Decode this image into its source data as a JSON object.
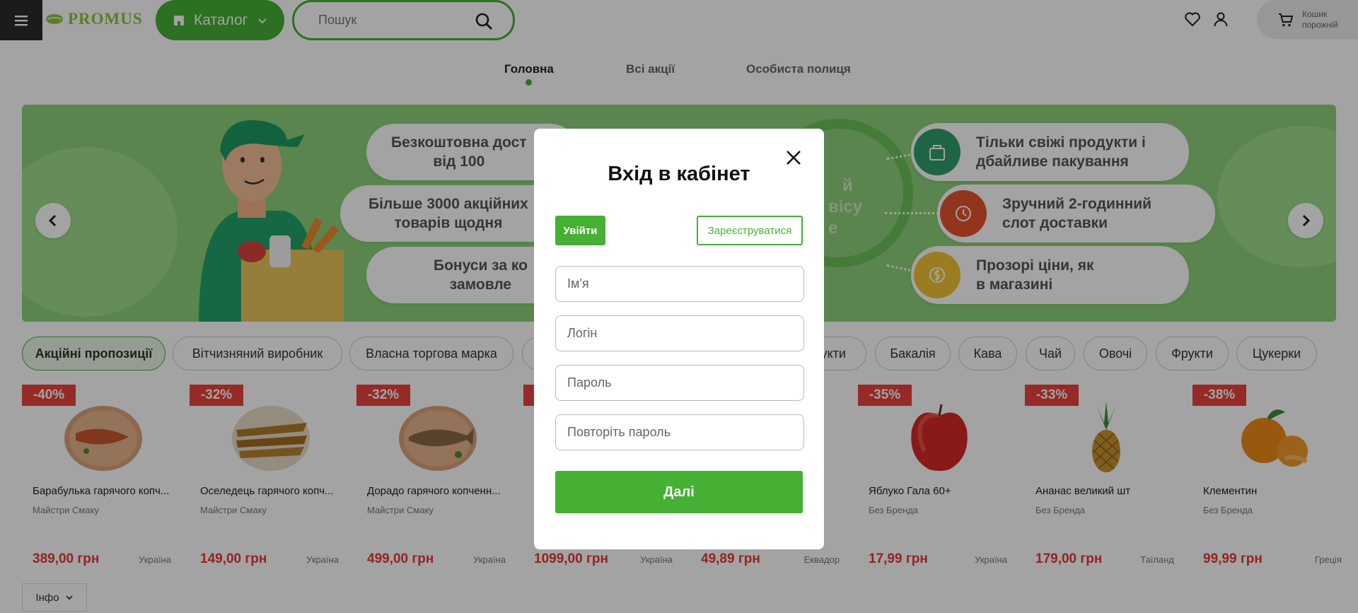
{
  "header": {
    "logo_text": "PROMUS",
    "catalog_label": "Каталог",
    "search_placeholder": "Пошук",
    "cart_line1": "Кошик",
    "cart_line2": "порожній"
  },
  "nav": {
    "tabs": [
      {
        "label": "Головна",
        "active": true
      },
      {
        "label": "Всі акції",
        "active": false
      },
      {
        "label": "Особиста полиця",
        "active": false
      }
    ]
  },
  "banner": {
    "pills_left": [
      {
        "line1": "Безкоштовна дост",
        "line2": "від 100"
      },
      {
        "line1": "Більше 3000 акційних",
        "line2": "товарів щодня"
      },
      {
        "line1": "Бонуси за ко",
        "line2": "замовле"
      }
    ],
    "pills_right": [
      {
        "line1": "Тільки свіжі продукти і",
        "line2": "дбайливе пакування",
        "icon": "grocery-bag-icon",
        "color": "#2e9e6b"
      },
      {
        "line1": "Зручний 2-годинний",
        "line2": "слот доставки",
        "icon": "clock-icon",
        "color": "#e4532e"
      },
      {
        "line1": "Прозорі ціни, як",
        "line2": "в магазині",
        "icon": "coin-icon",
        "color": "#f2c233"
      }
    ],
    "center_fragment": [
      "й",
      "вісу",
      "е"
    ]
  },
  "chips": [
    {
      "label": "Акційні пропозиції",
      "active": true
    },
    {
      "label": "Вітчизняний виробник",
      "active": false
    },
    {
      "label": "Власна торгова марка",
      "active": false
    },
    {
      "label": "укти",
      "active": false
    },
    {
      "label": "Бакалія",
      "active": false
    },
    {
      "label": "Кава",
      "active": false
    },
    {
      "label": "Чай",
      "active": false
    },
    {
      "label": "Овочі",
      "active": false
    },
    {
      "label": "Фрукти",
      "active": false
    },
    {
      "label": "Цукерки",
      "active": false
    }
  ],
  "products": [
    {
      "discount": "-40%",
      "name": "Барабулька гарячого копч...",
      "brand": "Майстри Смаку",
      "price": "389,00 грн",
      "origin": "Україна",
      "image": "fish-plate"
    },
    {
      "discount": "-32%",
      "name": "Оселедець гарячого копч...",
      "brand": "Майстри Смаку",
      "price": "149,00 грн",
      "origin": "Україна",
      "image": "herring-plate"
    },
    {
      "discount": "-32%",
      "name": "Дорадо гарячого копченн...",
      "brand": "Майстри Смаку",
      "price": "499,00 грн",
      "origin": "Україна",
      "image": "fish-plate"
    },
    {
      "discount": "",
      "name": "",
      "brand": "",
      "price": "1099,00 грн",
      "origin": "Україна",
      "image": ""
    },
    {
      "discount": "",
      "name": "",
      "brand": "",
      "price": "49,89 грн",
      "origin": "Еквадор",
      "image": ""
    },
    {
      "discount": "-35%",
      "name": "Яблуко Гала 60+",
      "brand": "Без Бренда",
      "price": "17,99 грн",
      "origin": "Україна",
      "image": "apple"
    },
    {
      "discount": "-33%",
      "name": "Ананас великий шт",
      "brand": "Без Бренда",
      "price": "179,00 грн",
      "origin": "Таїланд",
      "image": "pineapple"
    },
    {
      "discount": "-38%",
      "name": "Клементин",
      "brand": "Без Бренда",
      "price": "99,99 грн",
      "origin": "Греція",
      "image": "clementine"
    }
  ],
  "info_label": "Інфо",
  "modal": {
    "title": "Вхід в кабінет",
    "tab_login": "Увійти",
    "tab_register": "Зареєструватися",
    "fields": [
      {
        "placeholder": "Ім'я"
      },
      {
        "placeholder": "Логін"
      },
      {
        "placeholder": "Пароль"
      },
      {
        "placeholder": "Повторіть пароль"
      }
    ],
    "submit_label": "Далі"
  },
  "colors": {
    "brand_green": "#46b034",
    "discount_red": "#e9423c",
    "price_red": "#e53935"
  }
}
